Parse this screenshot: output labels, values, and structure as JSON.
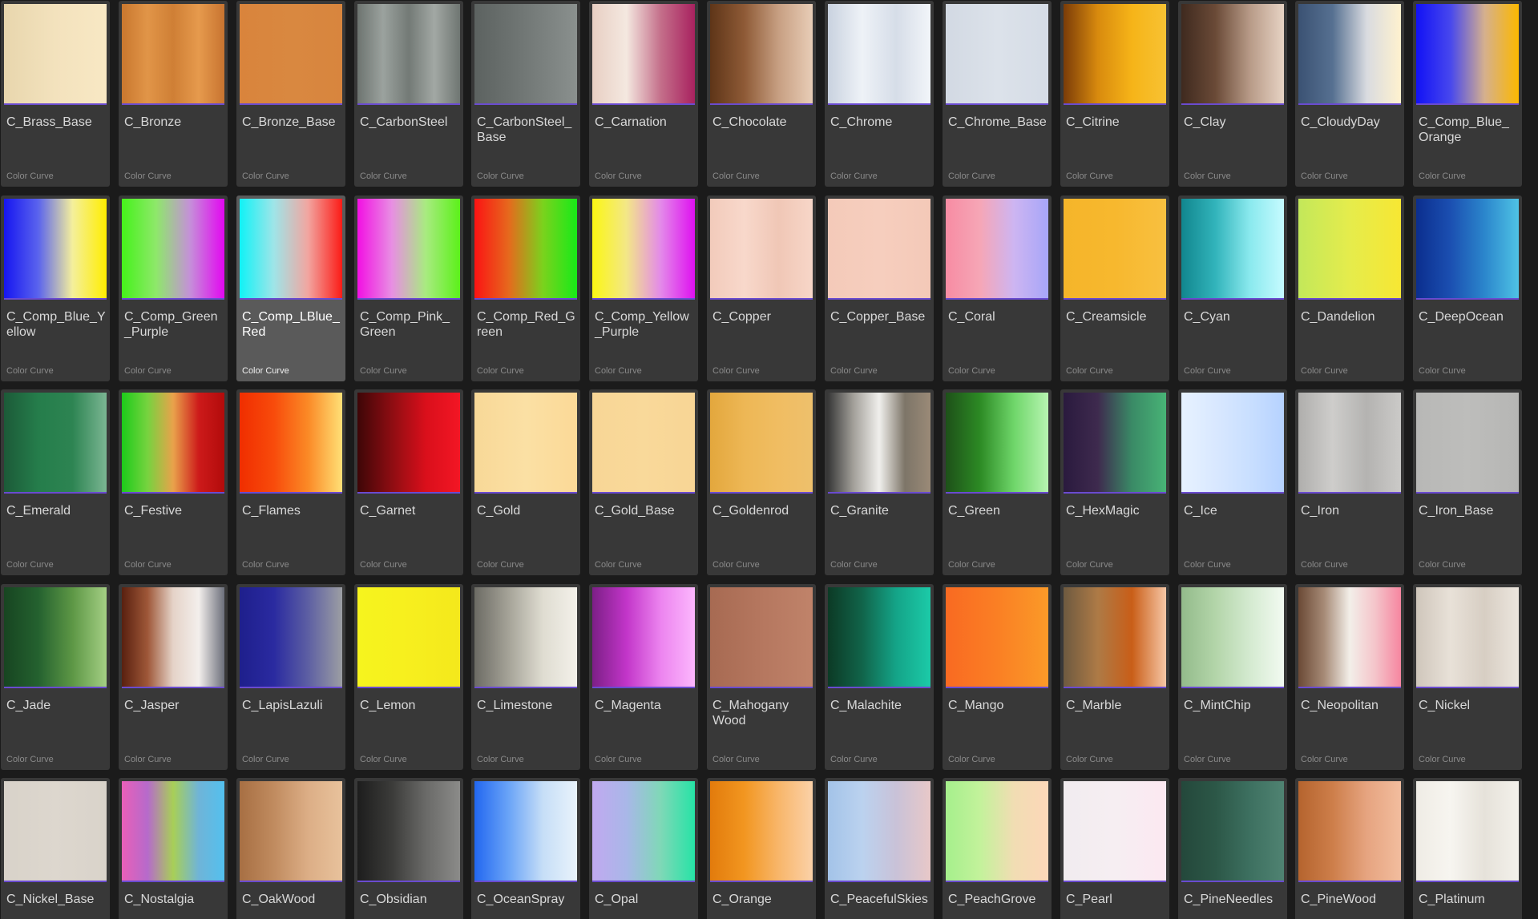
{
  "asset_type_label": "Color Curve",
  "selected_asset": "C_Comp_LBlue_Red",
  "assets": [
    {
      "name": "C_Brass_Base",
      "stops": [
        "#e8d6ad",
        "#f3e2bd",
        "#f8e8c4"
      ]
    },
    {
      "name": "C_Bronze",
      "stops": [
        "#c9772e",
        "#e19548",
        "#cf7f35",
        "#e69a4d",
        "#c87430"
      ]
    },
    {
      "name": "C_Bronze_Base",
      "stops": [
        "#d9843c",
        "#d98840",
        "#d8853e"
      ]
    },
    {
      "name": "C_CarbonSteel",
      "stops": [
        "#6d7470",
        "#9ba29e",
        "#737a76",
        "#a2a8a4",
        "#6f7672"
      ]
    },
    {
      "name": "C_CarbonSteel_Base",
      "stops": [
        "#5c6260",
        "#727876",
        "#8a908e"
      ]
    },
    {
      "name": "C_Carnation",
      "stops": [
        "#e8cfc3",
        "#f4e8e0",
        "#c46f8a",
        "#a8225f"
      ]
    },
    {
      "name": "C_Chocolate",
      "stops": [
        "#5e3518",
        "#8e5a36",
        "#c79f82",
        "#e8cdb7"
      ]
    },
    {
      "name": "C_Chrome",
      "stops": [
        "#c9d2df",
        "#eef2f7",
        "#d6dde8",
        "#f2f5f9"
      ]
    },
    {
      "name": "C_Chrome_Base",
      "stops": [
        "#d2d9e3",
        "#dce2ea",
        "#d5dce6"
      ]
    },
    {
      "name": "C_Citrine",
      "stops": [
        "#7b3c08",
        "#d88a0e",
        "#f6b418",
        "#f7c233"
      ]
    },
    {
      "name": "C_Clay",
      "stops": [
        "#3f2a1f",
        "#6a4a37",
        "#b79a87",
        "#e7d3c4"
      ]
    },
    {
      "name": "C_CloudyDay",
      "stops": [
        "#3b5273",
        "#567091",
        "#d9dbe0",
        "#fff2cf"
      ]
    },
    {
      "name": "C_Comp_Blue_Orange",
      "stops": [
        "#1212f5",
        "#4747ee",
        "#d5b08e",
        "#fcb800"
      ]
    },
    {
      "name": "C_Comp_Blue_Yellow",
      "stops": [
        "#1616f0",
        "#5a63ee",
        "#f4ef9c",
        "#ffee00"
      ]
    },
    {
      "name": "C_Comp_Green_Purple",
      "stops": [
        "#45f21a",
        "#8ee86a",
        "#c58fd9",
        "#e207f0"
      ]
    },
    {
      "name": "C_Comp_LBlue_Red",
      "stops": [
        "#10f2f6",
        "#9fe5e8",
        "#f2a5a0",
        "#fb1b16"
      ]
    },
    {
      "name": "C_Comp_Pink_Green",
      "stops": [
        "#f210e3",
        "#e88ee3",
        "#a8eb80",
        "#5cf01a"
      ]
    },
    {
      "name": "C_Comp_Red_Green",
      "stops": [
        "#fb1313",
        "#e6691d",
        "#7bd21d",
        "#18ea18"
      ]
    },
    {
      "name": "C_Comp_Yellow_Purple",
      "stops": [
        "#fbf713",
        "#f3e787",
        "#e38ae9",
        "#de10f0"
      ]
    },
    {
      "name": "C_Copper",
      "stops": [
        "#f2cbbb",
        "#f8d8cb",
        "#f0c7b6",
        "#f7d6c8"
      ]
    },
    {
      "name": "C_Copper_Base",
      "stops": [
        "#f4cab9",
        "#f6cebe",
        "#f4c9b8"
      ]
    },
    {
      "name": "C_Coral",
      "stops": [
        "#f78ca3",
        "#f6a6b6",
        "#cdb5f2",
        "#a7a6f8"
      ]
    },
    {
      "name": "C_Creamsicle",
      "stops": [
        "#f5b52a",
        "#f7b82e",
        "#f8c040"
      ]
    },
    {
      "name": "C_Cyan",
      "stops": [
        "#11868e",
        "#32b4bb",
        "#8ae9ee",
        "#c6fbff"
      ]
    },
    {
      "name": "C_Dandelion",
      "stops": [
        "#c3e85a",
        "#e5ec4c",
        "#f7e733"
      ]
    },
    {
      "name": "C_DeepOcean",
      "stops": [
        "#0b2e8e",
        "#1b4fb1",
        "#2b86cc",
        "#4fc3e5"
      ]
    },
    {
      "name": "C_Emerald",
      "stops": [
        "#1c5a38",
        "#257d4b",
        "#2d8452",
        "#7bb693"
      ]
    },
    {
      "name": "C_Festive",
      "stops": [
        "#1ccb1a",
        "#76d33f",
        "#e9a24b",
        "#cd1a1a",
        "#b20b0b"
      ]
    },
    {
      "name": "C_Flames",
      "stops": [
        "#f02e00",
        "#f84b0b",
        "#fb8a26",
        "#ffe076"
      ]
    },
    {
      "name": "C_Garnet",
      "stops": [
        "#3d0607",
        "#8d0d12",
        "#da0f1b",
        "#f31624"
      ]
    },
    {
      "name": "C_Gold",
      "stops": [
        "#f8d897",
        "#fbe0a4",
        "#fbd997"
      ]
    },
    {
      "name": "C_Gold_Base",
      "stops": [
        "#f8d696",
        "#f9d99a",
        "#f8d595"
      ]
    },
    {
      "name": "C_Goldenrod",
      "stops": [
        "#e3a73d",
        "#edb755",
        "#f0bd62",
        "#eec06c"
      ]
    },
    {
      "name": "C_Granite",
      "stops": [
        "#383838",
        "#a3a09a",
        "#f0efec",
        "#7d7568",
        "#9a8a77"
      ]
    },
    {
      "name": "C_Green",
      "stops": [
        "#1e5019",
        "#2c8a24",
        "#6fd66a",
        "#b7f5b1"
      ]
    },
    {
      "name": "C_HexMagic",
      "stops": [
        "#2a1a3e",
        "#3e2a4e",
        "#3a8a66",
        "#48b376"
      ]
    },
    {
      "name": "C_Ice",
      "stops": [
        "#e7f2ff",
        "#d9e8ff",
        "#c9dfff",
        "#b6d2ff"
      ]
    },
    {
      "name": "C_Iron",
      "stops": [
        "#afaeac",
        "#cecdcb",
        "#b4b3b1",
        "#cbcac8"
      ]
    },
    {
      "name": "C_Iron_Base",
      "stops": [
        "#b8b8b6",
        "#bdbdbb",
        "#b6b6b4"
      ]
    },
    {
      "name": "C_Jade",
      "stops": [
        "#174521",
        "#24612f",
        "#5d9745",
        "#a4cf84"
      ]
    },
    {
      "name": "C_Jasper",
      "stops": [
        "#59200f",
        "#9e5738",
        "#e5d3c8",
        "#f3efec",
        "#6c6f7b"
      ]
    },
    {
      "name": "C_LapisLazuli",
      "stops": [
        "#1e1f8c",
        "#2a2aa0",
        "#5d5fa3",
        "#9c9ea3"
      ]
    },
    {
      "name": "C_Lemon",
      "stops": [
        "#f6f41e",
        "#f7ef1e",
        "#f4e81c"
      ]
    },
    {
      "name": "C_Limestone",
      "stops": [
        "#6c6b64",
        "#a5a398",
        "#dfdcd1",
        "#f3f1ea"
      ]
    },
    {
      "name": "C_Magenta",
      "stops": [
        "#7c1f86",
        "#c235c9",
        "#ec84ef",
        "#fcb7fd"
      ]
    },
    {
      "name": "C_Mahogany Wood",
      "stops": [
        "#a76a52",
        "#b5775f",
        "#c0836a"
      ]
    },
    {
      "name": "C_Malachite",
      "stops": [
        "#0c3a25",
        "#11644a",
        "#14a488",
        "#1ccaa8"
      ]
    },
    {
      "name": "C_Mango",
      "stops": [
        "#f96a22",
        "#fa7f24",
        "#fb9a28"
      ]
    },
    {
      "name": "C_Marble",
      "stops": [
        "#6e5a40",
        "#ad7a46",
        "#c95e18",
        "#f6c6a5"
      ]
    },
    {
      "name": "C_MintChip",
      "stops": [
        "#93bb8b",
        "#b3d5a9",
        "#d4ead0",
        "#f2faf1"
      ]
    },
    {
      "name": "C_Neopolitan",
      "stops": [
        "#6b4a36",
        "#a68a76",
        "#f3efe9",
        "#f4c4ca",
        "#f686a0"
      ]
    },
    {
      "name": "C_Nickel",
      "stops": [
        "#cfc6bb",
        "#e8e1d8",
        "#d7cec3",
        "#ece6de"
      ]
    },
    {
      "name": "C_Nickel_Base",
      "stops": [
        "#d8d2c9",
        "#ddd7ce",
        "#d9d3ca"
      ]
    },
    {
      "name": "C_Nostalgia",
      "stops": [
        "#ea5fb8",
        "#b66acb",
        "#a8cf57",
        "#6fb4d8",
        "#53c0ee"
      ]
    },
    {
      "name": "C_OakWood",
      "stops": [
        "#a76f43",
        "#c08b5f",
        "#dcae86",
        "#e8c29c"
      ]
    },
    {
      "name": "C_Obsidian",
      "stops": [
        "#1d1d1d",
        "#3b3b39",
        "#6a6a68",
        "#8b8b89"
      ]
    },
    {
      "name": "C_OceanSpray",
      "stops": [
        "#2267f0",
        "#6aa4f7",
        "#c6def7",
        "#e9f3fb"
      ]
    },
    {
      "name": "C_Opal",
      "stops": [
        "#c1a9f0",
        "#a9b7e8",
        "#7fd8b7",
        "#26e3a6"
      ]
    },
    {
      "name": "C_Orange",
      "stops": [
        "#e27b0c",
        "#f29620",
        "#f8b66a",
        "#fbd1a8"
      ]
    },
    {
      "name": "C_PeacefulSkies",
      "stops": [
        "#a3c3e8",
        "#bbd2ef",
        "#c9c2d8",
        "#e8c8c8"
      ]
    },
    {
      "name": "C_PeachGrove",
      "stops": [
        "#a5ef8c",
        "#c3f29b",
        "#f1ddb3",
        "#fdd7b9"
      ]
    },
    {
      "name": "C_Pearl",
      "stops": [
        "#f1ecef",
        "#f6eef2",
        "#fce8f1"
      ]
    },
    {
      "name": "C_PineNeedles",
      "stops": [
        "#24483b",
        "#2c5747",
        "#3d7060",
        "#508372"
      ]
    },
    {
      "name": "C_PineWood",
      "stops": [
        "#b5642e",
        "#cd7e4a",
        "#e6a480",
        "#f2bd9e"
      ]
    },
    {
      "name": "C_Platinum",
      "stops": [
        "#efece5",
        "#f7f5f0",
        "#e6e2da",
        "#f3f1eb"
      ]
    }
  ]
}
